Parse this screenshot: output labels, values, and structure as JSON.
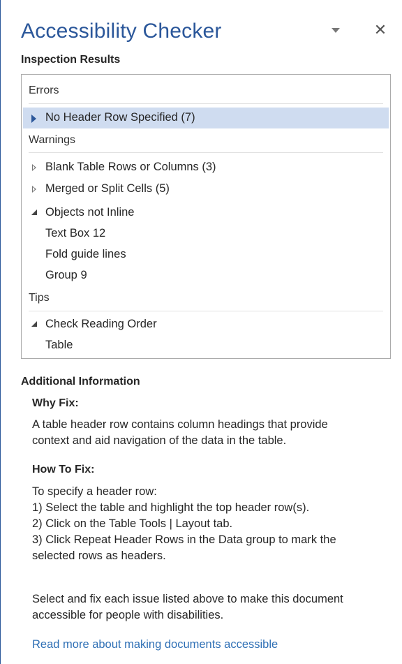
{
  "pane": {
    "title": "Accessibility Checker",
    "subtitle": "Inspection Results",
    "accent_color": "#2b579a",
    "icons": {
      "menu": "chevron-down-icon",
      "close": "close-icon"
    }
  },
  "results": {
    "errors_label": "Errors",
    "errors": [
      {
        "label": "No Header Row Specified (7)",
        "state": "selected-collapsed"
      }
    ],
    "warnings_label": "Warnings",
    "warnings": [
      {
        "label": "Blank Table Rows or Columns (3)",
        "state": "collapsed"
      },
      {
        "label": "Merged or Split Cells (5)",
        "state": "collapsed"
      },
      {
        "label": "Objects not Inline",
        "state": "expanded",
        "children": [
          "Text Box 12",
          "Fold guide lines",
          "Group 9"
        ]
      }
    ],
    "tips_label": "Tips",
    "tips": [
      {
        "label": "Check Reading Order",
        "state": "expanded",
        "children": [
          "Table"
        ]
      }
    ]
  },
  "info": {
    "heading": "Additional Information",
    "why_heading": "Why Fix:",
    "why_lines": [
      "A table header row contains column headings that provide",
      "context and aid navigation of the data in the table."
    ],
    "how_heading": "How To Fix:",
    "how_lines": [
      "To specify a header row:",
      "1) Select the table and highlight the top header row(s).",
      "2) Click on the Table Tools | Layout tab.",
      "3) Click Repeat Header Rows in the Data group to mark the",
      "selected rows as headers."
    ],
    "note_lines": [
      "Select and fix each issue listed above to make this document",
      "accessible for people with disabilities."
    ],
    "link": "Read more about making documents accessible"
  }
}
